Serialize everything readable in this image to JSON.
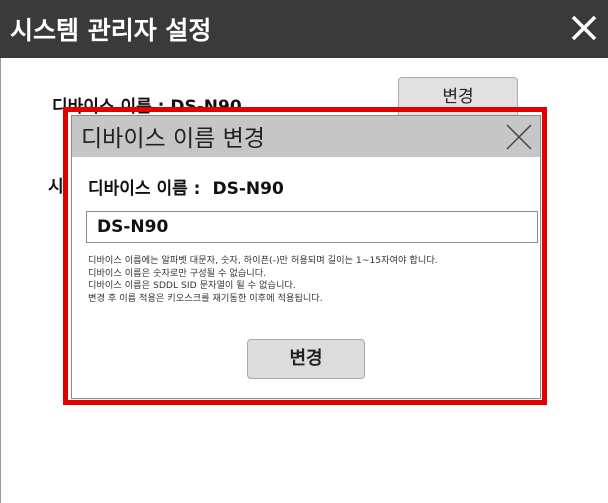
{
  "window": {
    "title": "시스템 관리자 설정",
    "close_icon": "close-icon"
  },
  "background": {
    "device_name_label": "디바이스 이름 :  DS-N90",
    "change_button": "변경",
    "second_label": "시"
  },
  "dialog": {
    "title": "디바이스 이름 변경",
    "name_label": "디바이스 이름 :",
    "name_value": "DS-N90",
    "input_value": "DS-N90",
    "hints": [
      "디바이스 이름에는 알파벳 대문자, 숫자, 하이픈(-)만 허용되며 길이는 1~15자여야 합니다.",
      "디바이스 이름은 숫자로만 구성될 수 없습니다.",
      "디바이스 이름은 SDDL SID 문자열이 될 수 없습니다.",
      "변경 후 이름 적용은 키오스크를 재기동한 이후에 적용됩니다."
    ],
    "change_button": "변경"
  },
  "colors": {
    "titlebar_bg": "#3a3a3a",
    "highlight": "#e00000",
    "dialog_header_bg": "#c6c6c6"
  }
}
